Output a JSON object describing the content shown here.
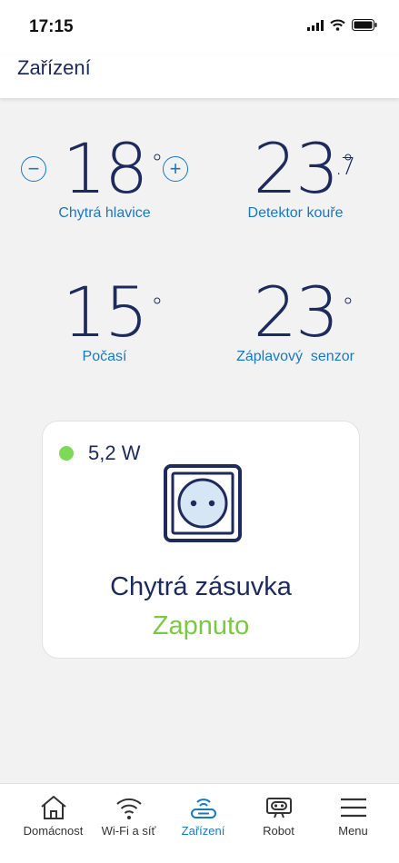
{
  "status_bar": {
    "time": "17:15"
  },
  "header": {
    "title": "Zařízení"
  },
  "tiles": [
    {
      "value": "18",
      "degree": "°",
      "label": "Chytrá hlavice",
      "minus": "−",
      "plus": "+"
    },
    {
      "value": "23",
      "degree": "°",
      "decimal": ".7",
      "label": "Detektor kouře"
    },
    {
      "value": "15",
      "degree": "°",
      "label": "Počasí"
    },
    {
      "value": "23",
      "degree": "°",
      "label": "Záplavový  senzor"
    }
  ],
  "socket_card": {
    "power": "5,2 W",
    "title": "Chytrá zásuvka",
    "status": "Zapnuto"
  },
  "tabs": [
    {
      "label": "Domácnost",
      "icon": "home-icon"
    },
    {
      "label": "Wi-Fi a síť",
      "icon": "wifi-icon"
    },
    {
      "label": "Zařízení",
      "icon": "router-icon",
      "active": true
    },
    {
      "label": "Robot",
      "icon": "robot-icon"
    },
    {
      "label": "Menu",
      "icon": "menu-icon"
    }
  ],
  "colors": {
    "navy": "#1d2a5b",
    "accent_blue": "#1b78c0",
    "green": "#7ac943",
    "background": "#f2f2f2"
  }
}
